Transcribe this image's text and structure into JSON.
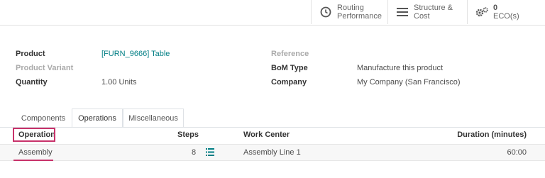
{
  "smart_buttons": {
    "routing": {
      "line1": "Routing",
      "line2": "Performance",
      "icon": "clock-icon"
    },
    "structure": {
      "line1": "Structure &",
      "line2": "Cost",
      "icon": "bars-icon"
    },
    "eco": {
      "count": "0",
      "label": "ECO(s)",
      "icon": "gears-icon"
    }
  },
  "fields": {
    "product_label": "Product",
    "product_value": "[FURN_9666] Table",
    "variant_label": "Product Variant",
    "quantity_label": "Quantity",
    "quantity_value": "1.00",
    "quantity_unit": "Units",
    "reference_label": "Reference",
    "bom_type_label": "BoM Type",
    "bom_type_value": "Manufacture this product",
    "company_label": "Company",
    "company_value": "My Company (San Francisco)"
  },
  "tabs": [
    {
      "label": "Components"
    },
    {
      "label": "Operations"
    },
    {
      "label": "Miscellaneous"
    }
  ],
  "table": {
    "headers": {
      "operation": "Operation",
      "steps": "Steps",
      "work_center": "Work Center",
      "duration": "Duration (minutes)"
    },
    "rows": [
      {
        "operation": "Assembly",
        "steps": "8",
        "work_center": "Assembly Line 1",
        "duration": "60:00"
      }
    ]
  },
  "colors": {
    "accent": "#c8326a",
    "link": "#017e84",
    "icon_teal": "#017e84"
  }
}
